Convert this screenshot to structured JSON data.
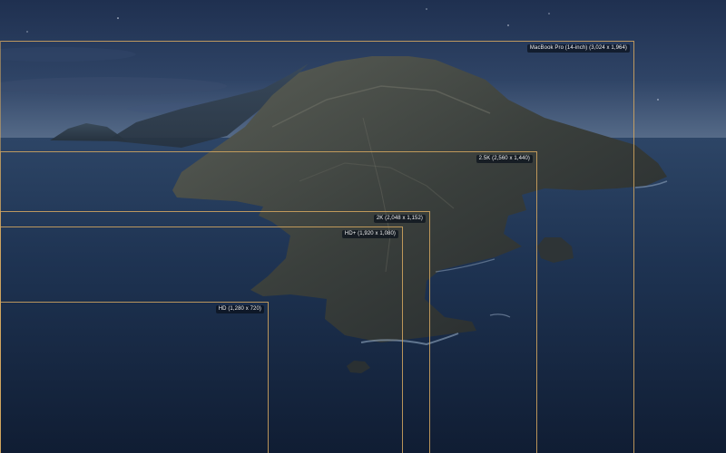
{
  "screen": {
    "background": "macOS Catalina island wallpaper",
    "accent_color": "#d6a860"
  },
  "resolutions": [
    {
      "id": "macbook",
      "label": "MacBook Pro (14-inch) (3,024 x 1,964)"
    },
    {
      "id": "2-5k",
      "label": "2.5K (2,560 x 1,440)"
    },
    {
      "id": "2k",
      "label": "2K (2,048 x 1,152)"
    },
    {
      "id": "hdplus",
      "label": "HD+ (1,920 x 1,080)"
    },
    {
      "id": "hd",
      "label": "HD (1,280 x 720)"
    }
  ]
}
